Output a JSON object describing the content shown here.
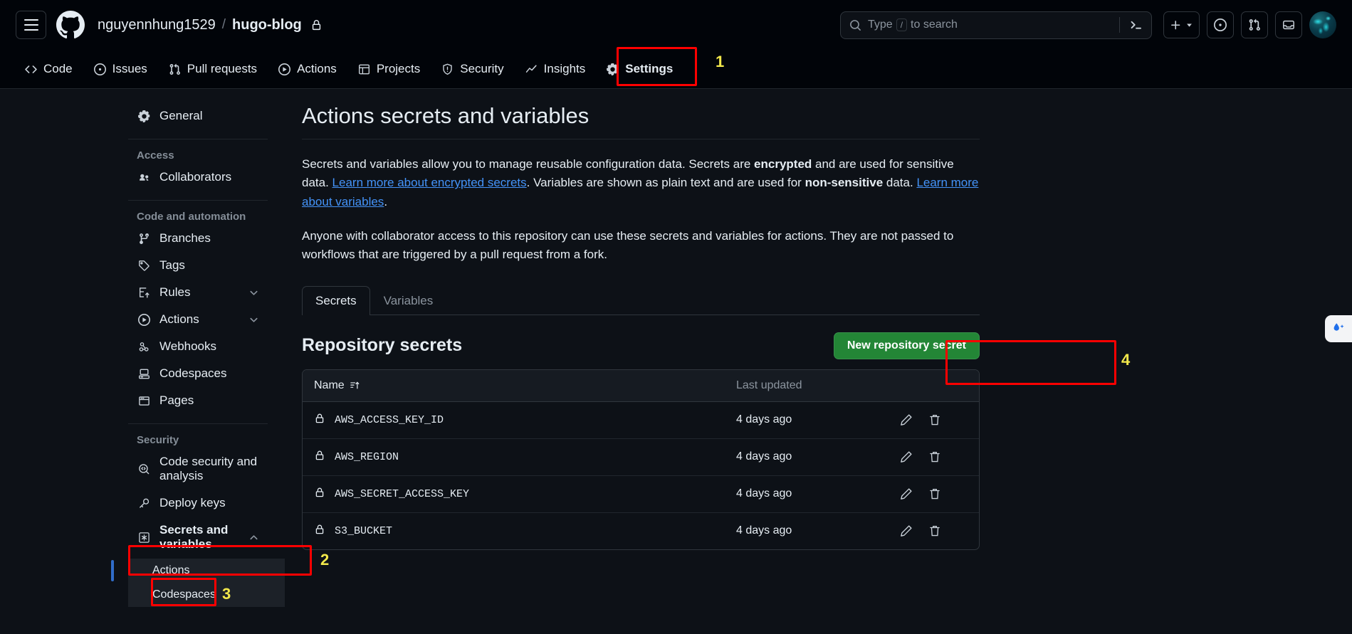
{
  "header": {
    "menu_icon": "hamburger-icon",
    "logo_icon": "github-logo-icon",
    "owner": "nguyennhung1529",
    "separator": "/",
    "repo": "hugo-blog",
    "repo_visibility_icon": "lock-icon",
    "search": {
      "placeholder_prefix": "Type",
      "slash_key": "/",
      "placeholder_suffix": "to search",
      "search_icon": "search-icon",
      "terminal_icon": "terminal-icon"
    },
    "actions": [
      {
        "name": "create-new-button",
        "icon": "plus-icon",
        "has_caret": true
      },
      {
        "name": "issues-button",
        "icon": "issue-opened-icon",
        "has_caret": false
      },
      {
        "name": "pull-requests-button",
        "icon": "git-pull-request-icon",
        "has_caret": false
      },
      {
        "name": "notifications-button",
        "icon": "inbox-icon",
        "has_caret": false
      }
    ],
    "avatar_name": "user-avatar"
  },
  "repo_nav": {
    "tabs": [
      {
        "label": "Code",
        "icon": "code-icon",
        "selected": false
      },
      {
        "label": "Issues",
        "icon": "issue-opened-icon",
        "selected": false
      },
      {
        "label": "Pull requests",
        "icon": "git-pull-request-icon",
        "selected": false
      },
      {
        "label": "Actions",
        "icon": "play-icon",
        "selected": false
      },
      {
        "label": "Projects",
        "icon": "table-icon",
        "selected": false
      },
      {
        "label": "Security",
        "icon": "shield-icon",
        "selected": false
      },
      {
        "label": "Insights",
        "icon": "graph-icon",
        "selected": false
      },
      {
        "label": "Settings",
        "icon": "gear-icon",
        "selected": true
      }
    ]
  },
  "sidebar": {
    "general": {
      "label": "General",
      "icon": "gear-icon"
    },
    "groups": [
      {
        "title": "Access",
        "items": [
          {
            "label": "Collaborators",
            "icon": "people-icon"
          }
        ]
      },
      {
        "title": "Code and automation",
        "items": [
          {
            "label": "Branches",
            "icon": "git-branch-icon"
          },
          {
            "label": "Tags",
            "icon": "tag-icon"
          },
          {
            "label": "Rules",
            "icon": "rules-icon",
            "caret": "chevron-down-icon"
          },
          {
            "label": "Actions",
            "icon": "play-icon",
            "caret": "chevron-down-icon"
          },
          {
            "label": "Webhooks",
            "icon": "webhook-icon"
          },
          {
            "label": "Codespaces",
            "icon": "codespaces-icon"
          },
          {
            "label": "Pages",
            "icon": "browser-icon"
          }
        ]
      },
      {
        "title": "Security",
        "items": [
          {
            "label": "Code security and analysis",
            "icon": "codescan-icon"
          },
          {
            "label": "Deploy keys",
            "icon": "key-icon"
          }
        ]
      }
    ],
    "secrets_and_variables": {
      "label": "Secrets and variables",
      "icon": "asterisk-icon",
      "caret": "chevron-up-icon"
    },
    "sub_items": [
      {
        "label": "Actions",
        "active": true
      },
      {
        "label": "Codespaces",
        "active": false
      }
    ]
  },
  "main": {
    "title": "Actions secrets and variables",
    "paragraph1": {
      "p1": "Secrets and variables allow you to manage reusable configuration data. Secrets are ",
      "b1": "encrypted",
      "p2": " and are used for sensitive data. ",
      "link1": "Learn more about encrypted secrets",
      "p3": ". Variables are shown as plain text and are used for ",
      "b2": "non-sensitive",
      "p4": " data. ",
      "link2": "Learn more about variables",
      "p5": "."
    },
    "paragraph2": "Anyone with collaborator access to this repository can use these secrets and variables for actions. They are not passed to workflows that are triggered by a pull request from a fork.",
    "tabs": [
      {
        "label": "Secrets",
        "active": true
      },
      {
        "label": "Variables",
        "active": false
      }
    ],
    "section_title": "Repository secrets",
    "new_secret_button": "New repository secret",
    "table": {
      "columns": {
        "name": "Name",
        "last_updated": "Last updated"
      },
      "sort_icon": "sort-asc-icon",
      "rows": [
        {
          "icon": "lock-icon",
          "name": "AWS_ACCESS_KEY_ID",
          "last_updated": "4 days ago",
          "edit_icon": "pencil-icon",
          "delete_icon": "trash-icon"
        },
        {
          "icon": "lock-icon",
          "name": "AWS_REGION",
          "last_updated": "4 days ago",
          "edit_icon": "pencil-icon",
          "delete_icon": "trash-icon"
        },
        {
          "icon": "lock-icon",
          "name": "AWS_SECRET_ACCESS_KEY",
          "last_updated": "4 days ago",
          "edit_icon": "pencil-icon",
          "delete_icon": "trash-icon"
        },
        {
          "icon": "lock-icon",
          "name": "S3_BUCKET",
          "last_updated": "4 days ago",
          "edit_icon": "pencil-icon",
          "delete_icon": "trash-icon"
        }
      ]
    }
  },
  "annotations": [
    {
      "number": "1",
      "target": "settings-tab"
    },
    {
      "number": "2",
      "target": "secrets-and-variables-sidebar-item"
    },
    {
      "number": "3",
      "target": "actions-sub-item"
    },
    {
      "number": "4",
      "target": "new-repository-secret-button"
    }
  ],
  "colors": {
    "accent_green": "#238636",
    "annotation_red": "#ff0000",
    "annotation_number": "#f2e84b",
    "link_blue": "#4493f8",
    "active_indicator": "#316dca"
  },
  "float_widget": {
    "icon": "water-drop-sparkle-icon"
  }
}
